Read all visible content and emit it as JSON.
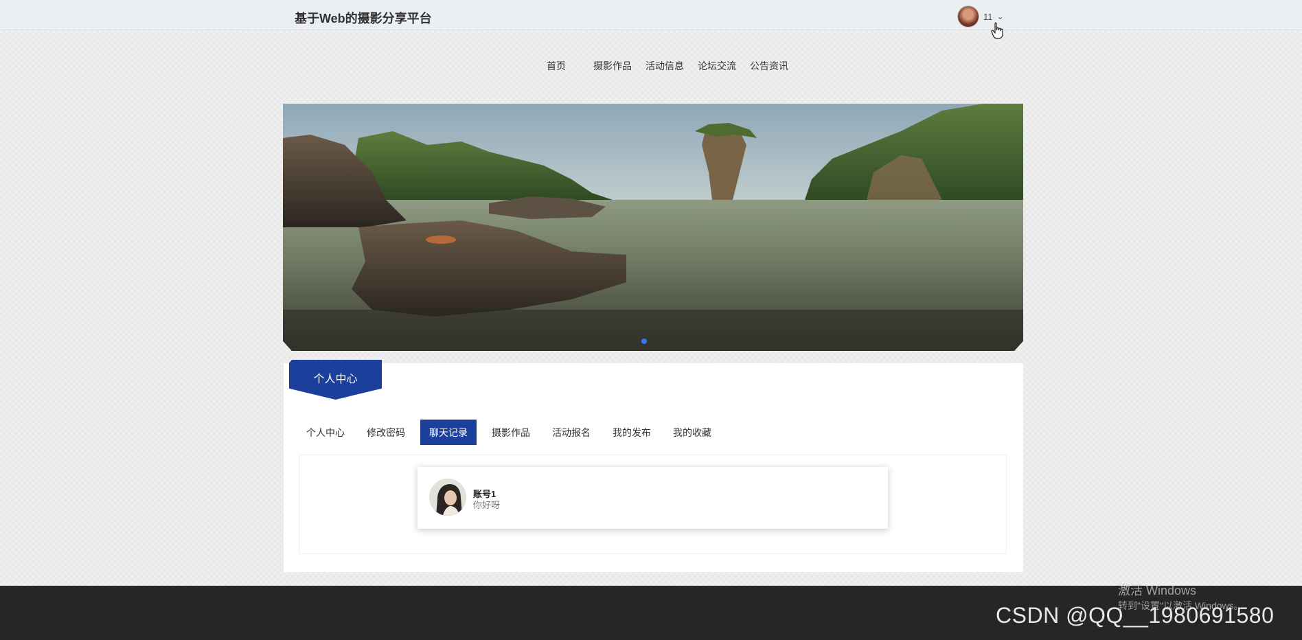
{
  "header": {
    "site_title": "基于Web的摄影分享平台",
    "user_name": "11",
    "dropdown_icon": "chevron-down-icon"
  },
  "nav": {
    "items": [
      {
        "label": "首页"
      },
      {
        "label": "摄影作品"
      },
      {
        "label": "活动信息"
      },
      {
        "label": "论坛交流"
      },
      {
        "label": "公告资讯"
      }
    ]
  },
  "banner": {
    "active_slide": 1,
    "slide_count": 1
  },
  "personal": {
    "ribbon_label": "个人中心",
    "tabs": [
      {
        "label": "个人中心",
        "active": false
      },
      {
        "label": "修改密码",
        "active": false
      },
      {
        "label": "聊天记录",
        "active": true
      },
      {
        "label": "摄影作品",
        "active": false
      },
      {
        "label": "活动报名",
        "active": false
      },
      {
        "label": "我的发布",
        "active": false
      },
      {
        "label": "我的收藏",
        "active": false
      }
    ],
    "chat": [
      {
        "name": "账号1",
        "message": "你好呀"
      }
    ]
  },
  "overlay": {
    "activate_title": "激活 Windows",
    "activate_sub": "转到\"设置\"以激活 Windows。",
    "watermark": "CSDN @QQ__1980691580"
  },
  "colors": {
    "accent": "#1c3f9c",
    "dot": "#2d78ff"
  }
}
